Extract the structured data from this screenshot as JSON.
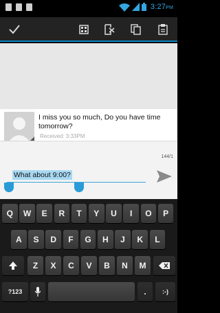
{
  "status_bar": {
    "time": "3:27",
    "time_suffix": "PM"
  },
  "action_bar": {
    "icons": [
      "check-icon",
      "grid-icon",
      "export-icon",
      "copy-icon",
      "paste-icon"
    ]
  },
  "message": {
    "text": "I miss you so much, Do you have time tomorrow?",
    "timestamp": "Received: 3:33PM"
  },
  "compose": {
    "counter": "144/1",
    "input_value": "What about 9:00?"
  },
  "keyboard": {
    "row1": [
      "Q",
      "W",
      "E",
      "R",
      "T",
      "Y",
      "U",
      "I",
      "O",
      "P"
    ],
    "row2": [
      "A",
      "S",
      "D",
      "F",
      "G",
      "H",
      "J",
      "K",
      "L"
    ],
    "row3": [
      "Z",
      "X",
      "C",
      "V",
      "B",
      "N",
      "M"
    ],
    "symbols_label": "?123",
    "period_label": ".",
    "emoji_label": ":-)"
  },
  "colors": {
    "accent": "#0b87c9",
    "selection": "#a8d8f2",
    "clock": "#34a5e0"
  }
}
